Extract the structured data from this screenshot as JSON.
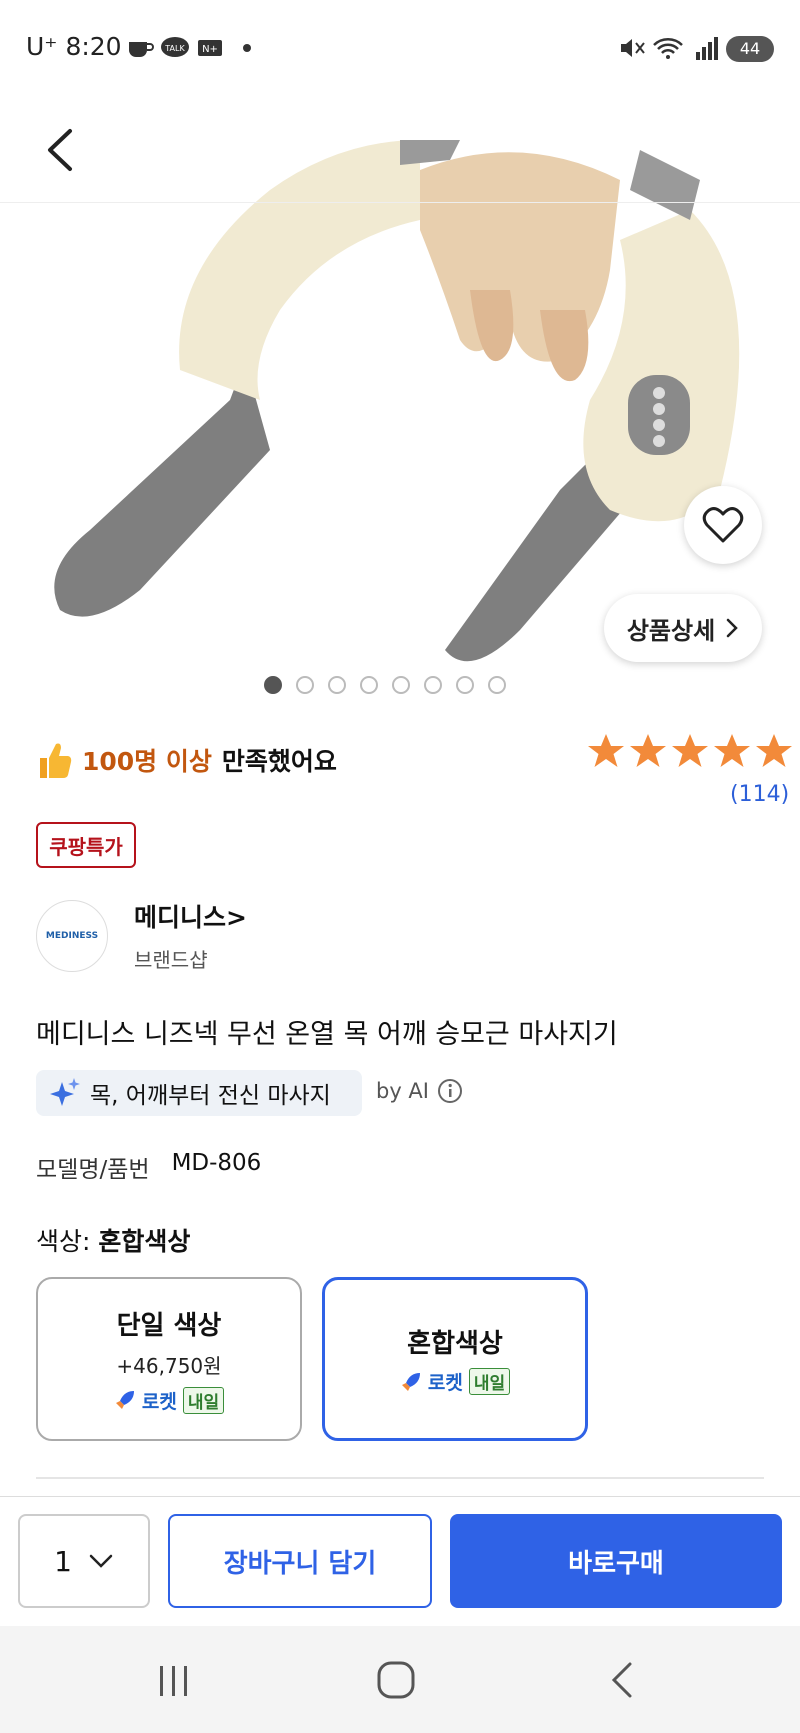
{
  "status_bar": {
    "time": "U⁺ 8:20",
    "battery": "44"
  },
  "product": {
    "image_count": 8,
    "active_image_index": 0,
    "detail_button": "상품상세",
    "satisfaction": {
      "highlight": "100명 이상",
      "text": "만족했어요"
    },
    "rating": 5,
    "review_count": "(114)",
    "badge": "쿠팡특가",
    "brand": {
      "name": "메디니스>",
      "subtitle": "브랜드샵",
      "logo_text": "MEDINESS"
    },
    "title": "메디니스 니즈넥 무선 온열 목 어깨 승모근 마사지기",
    "ai_summary": "목, 어깨부터 전신 마사지",
    "ai_label": "by AI",
    "model_label": "모델명/품번",
    "model_value": "MD-806",
    "color_label": "색상:",
    "color_value": "혼합색상",
    "options": [
      {
        "title": "단일 색상",
        "price": "+46,750원",
        "delivery": "로켓",
        "delivery_tag": "내일",
        "selected": false
      },
      {
        "title": "혼합색상",
        "delivery": "로켓",
        "delivery_tag": "내일",
        "selected": true
      }
    ]
  },
  "purchase_bar": {
    "quantity": "1",
    "cart_button": "장바구니 담기",
    "buy_button": "바로구매"
  },
  "colors": {
    "accent_blue": "#2f62e6",
    "badge_red": "#b5121b",
    "star_orange": "#f28a3a",
    "satisfaction_orange": "#c2570f"
  }
}
